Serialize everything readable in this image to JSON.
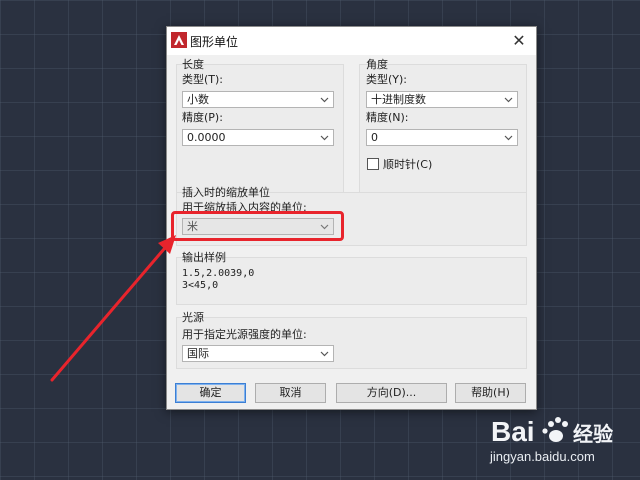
{
  "dialog": {
    "title": "图形单位",
    "close_glyph": "✕"
  },
  "length": {
    "legend": "长度",
    "type_label": "类型(T):",
    "type_value": "小数",
    "precision_label": "精度(P):",
    "precision_value": "0.0000"
  },
  "angle": {
    "legend": "角度",
    "type_label": "类型(Y):",
    "type_value": "十进制度数",
    "precision_label": "精度(N):",
    "precision_value": "0",
    "clockwise_label": "顺时针(C)",
    "clockwise_checked": false
  },
  "insertion": {
    "legend": "插入时的缩放单位",
    "label": "用于缩放插入内容的单位:",
    "value": "米"
  },
  "preview": {
    "legend": "输出样例",
    "line1": "1.5,2.0039,0",
    "line2": "3<45,0"
  },
  "lighting": {
    "legend": "光源",
    "label": "用于指定光源强度的单位:",
    "value": "国际"
  },
  "buttons": {
    "ok": "确定",
    "cancel": "取消",
    "direction": "方向(D)...",
    "help": "帮助(H)"
  },
  "watermark": {
    "brand_latin": "Bai",
    "brand_cn": "经验",
    "url": "jingyan.baidu.com"
  },
  "colors": {
    "highlight": "#e8242c",
    "arrow": "#e8242c",
    "accent": "#3c7fd4"
  }
}
